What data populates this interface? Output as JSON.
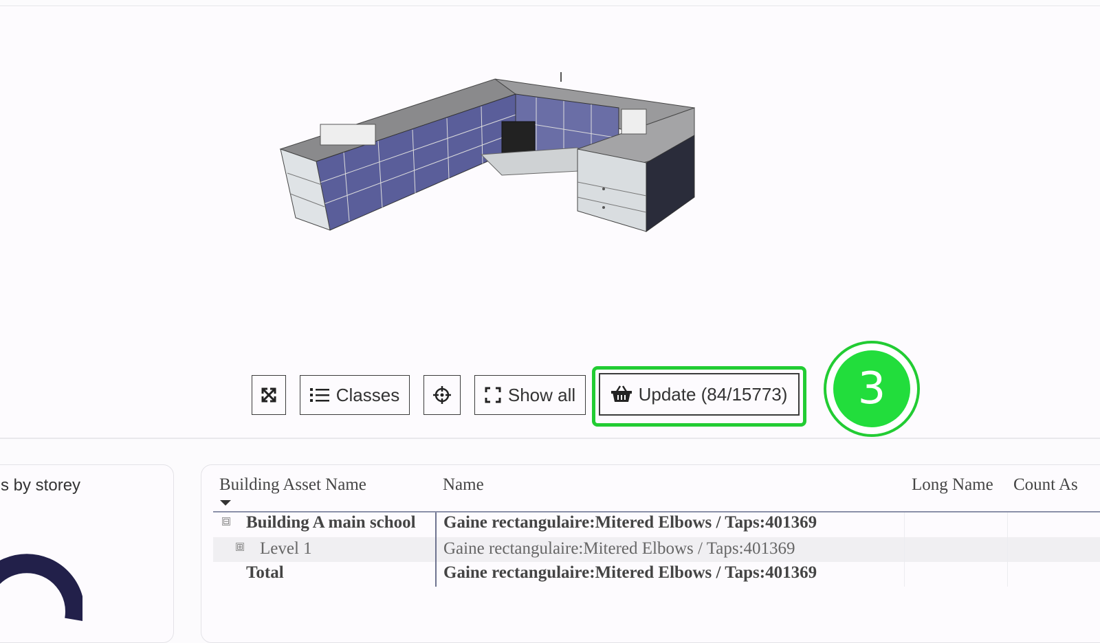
{
  "toolbar": {
    "classes_label": "Classes",
    "show_all_label": "Show all",
    "update_label": "Update (84/15773)"
  },
  "step_badge": "3",
  "left_panel": {
    "title": "s by storey"
  },
  "table": {
    "headers": [
      "Building Asset Name",
      "Name",
      "Long Name",
      "Count As"
    ],
    "rows": [
      {
        "asset": "Building A main school",
        "name": "Gaine rectangulaire:Mitered Elbows / Taps:401369",
        "toggle": "⊟",
        "bold": true
      },
      {
        "asset": "Level 1",
        "name": "Gaine rectangulaire:Mitered Elbows / Taps:401369",
        "toggle": "⊞",
        "bold": false
      },
      {
        "asset": "Total",
        "name": "Gaine rectangulaire:Mitered Elbows / Taps:401369",
        "bold": true
      }
    ]
  },
  "colors": {
    "highlight": "#22cc33",
    "badge": "#22dd3c",
    "donut": "#22204a"
  },
  "icons": [
    "fit-view-icon",
    "list-icon",
    "crosshair-icon",
    "expand-icon",
    "basket-icon"
  ]
}
